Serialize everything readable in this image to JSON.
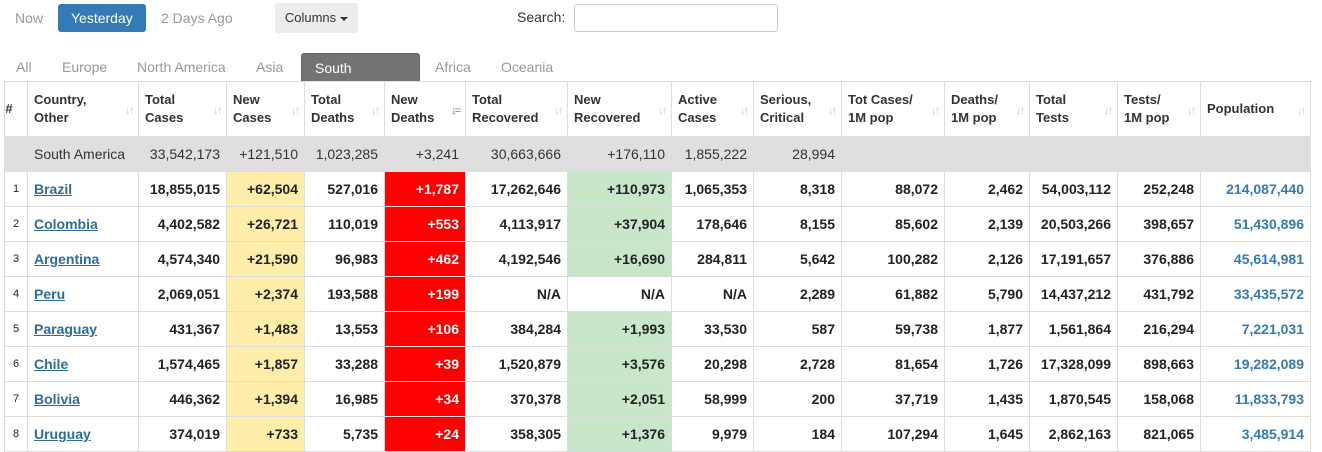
{
  "day_tabs": [
    {
      "label": "Now",
      "active": false
    },
    {
      "label": "Yesterday",
      "active": true
    },
    {
      "label": "2 Days Ago",
      "active": false
    }
  ],
  "columns_label": "Columns",
  "search": {
    "label": "Search:",
    "value": ""
  },
  "region_tabs": [
    {
      "label": "All",
      "active": false
    },
    {
      "label": "Europe",
      "active": false
    },
    {
      "label": "North America",
      "active": false
    },
    {
      "label": "Asia",
      "active": false
    },
    {
      "label": "South America",
      "active": true
    },
    {
      "label": "Africa",
      "active": false
    },
    {
      "label": "Oceania",
      "active": false
    }
  ],
  "columns": [
    {
      "label": "#"
    },
    {
      "label": "Country, Other"
    },
    {
      "label": "Total Cases"
    },
    {
      "label": "New Cases"
    },
    {
      "label": "Total Deaths"
    },
    {
      "label": "New Deaths",
      "sorted": true
    },
    {
      "label": "Total Recovered"
    },
    {
      "label": "New Recovered"
    },
    {
      "label": "Active Cases"
    },
    {
      "label": "Serious, Critical"
    },
    {
      "label": "Tot Cases/ 1M pop"
    },
    {
      "label": "Deaths/ 1M pop"
    },
    {
      "label": "Total Tests"
    },
    {
      "label": "Tests/ 1M pop"
    },
    {
      "label": "Population"
    }
  ],
  "sort_icons": {
    "default": "↓↑",
    "sorted": "↓="
  },
  "total_row": {
    "country": "South America",
    "total_cases": "33,542,173",
    "new_cases": "+121,510",
    "total_deaths": "1,023,285",
    "new_deaths": "+3,241",
    "total_recovered": "30,663,666",
    "new_recovered": "+176,110",
    "active_cases": "1,855,222",
    "serious": "28,994"
  },
  "rows": [
    {
      "rank": "1",
      "country": "Brazil",
      "total_cases": "18,855,015",
      "new_cases": "+62,504",
      "total_deaths": "527,016",
      "new_deaths": "+1,787",
      "total_recovered": "17,262,646",
      "new_recovered": "+110,973",
      "active_cases": "1,065,353",
      "serious": "8,318",
      "cases_per_m": "88,072",
      "deaths_per_m": "2,462",
      "total_tests": "54,003,112",
      "tests_per_m": "252,248",
      "population": "214,087,440"
    },
    {
      "rank": "2",
      "country": "Colombia",
      "total_cases": "4,402,582",
      "new_cases": "+26,721",
      "total_deaths": "110,019",
      "new_deaths": "+553",
      "total_recovered": "4,113,917",
      "new_recovered": "+37,904",
      "active_cases": "178,646",
      "serious": "8,155",
      "cases_per_m": "85,602",
      "deaths_per_m": "2,139",
      "total_tests": "20,503,266",
      "tests_per_m": "398,657",
      "population": "51,430,896"
    },
    {
      "rank": "3",
      "country": "Argentina",
      "total_cases": "4,574,340",
      "new_cases": "+21,590",
      "total_deaths": "96,983",
      "new_deaths": "+462",
      "total_recovered": "4,192,546",
      "new_recovered": "+16,690",
      "active_cases": "284,811",
      "serious": "5,642",
      "cases_per_m": "100,282",
      "deaths_per_m": "2,126",
      "total_tests": "17,191,657",
      "tests_per_m": "376,886",
      "population": "45,614,981"
    },
    {
      "rank": "4",
      "country": "Peru",
      "total_cases": "2,069,051",
      "new_cases": "+2,374",
      "total_deaths": "193,588",
      "new_deaths": "+199",
      "total_recovered": "N/A",
      "new_recovered": "N/A",
      "active_cases": "N/A",
      "serious": "2,289",
      "cases_per_m": "61,882",
      "deaths_per_m": "5,790",
      "total_tests": "14,437,212",
      "tests_per_m": "431,792",
      "population": "33,435,572",
      "no_rec_highlight": true
    },
    {
      "rank": "5",
      "country": "Paraguay",
      "total_cases": "431,367",
      "new_cases": "+1,483",
      "total_deaths": "13,553",
      "new_deaths": "+106",
      "total_recovered": "384,284",
      "new_recovered": "+1,993",
      "active_cases": "33,530",
      "serious": "587",
      "cases_per_m": "59,738",
      "deaths_per_m": "1,877",
      "total_tests": "1,561,864",
      "tests_per_m": "216,294",
      "population": "7,221,031"
    },
    {
      "rank": "6",
      "country": "Chile",
      "total_cases": "1,574,465",
      "new_cases": "+1,857",
      "total_deaths": "33,288",
      "new_deaths": "+39",
      "total_recovered": "1,520,879",
      "new_recovered": "+3,576",
      "active_cases": "20,298",
      "serious": "2,728",
      "cases_per_m": "81,654",
      "deaths_per_m": "1,726",
      "total_tests": "17,328,099",
      "tests_per_m": "898,663",
      "population": "19,282,089"
    },
    {
      "rank": "7",
      "country": "Bolivia",
      "total_cases": "446,362",
      "new_cases": "+1,394",
      "total_deaths": "16,985",
      "new_deaths": "+34",
      "total_recovered": "370,378",
      "new_recovered": "+2,051",
      "active_cases": "58,999",
      "serious": "200",
      "cases_per_m": "37,719",
      "deaths_per_m": "1,435",
      "total_tests": "1,870,545",
      "tests_per_m": "158,068",
      "population": "11,833,793"
    },
    {
      "rank": "8",
      "country": "Uruguay",
      "total_cases": "374,019",
      "new_cases": "+733",
      "total_deaths": "5,735",
      "new_deaths": "+24",
      "total_recovered": "358,305",
      "new_recovered": "+1,376",
      "active_cases": "9,979",
      "serious": "184",
      "cases_per_m": "107,294",
      "deaths_per_m": "1,645",
      "total_tests": "2,862,163",
      "tests_per_m": "821,065",
      "population": "3,485,914"
    }
  ]
}
